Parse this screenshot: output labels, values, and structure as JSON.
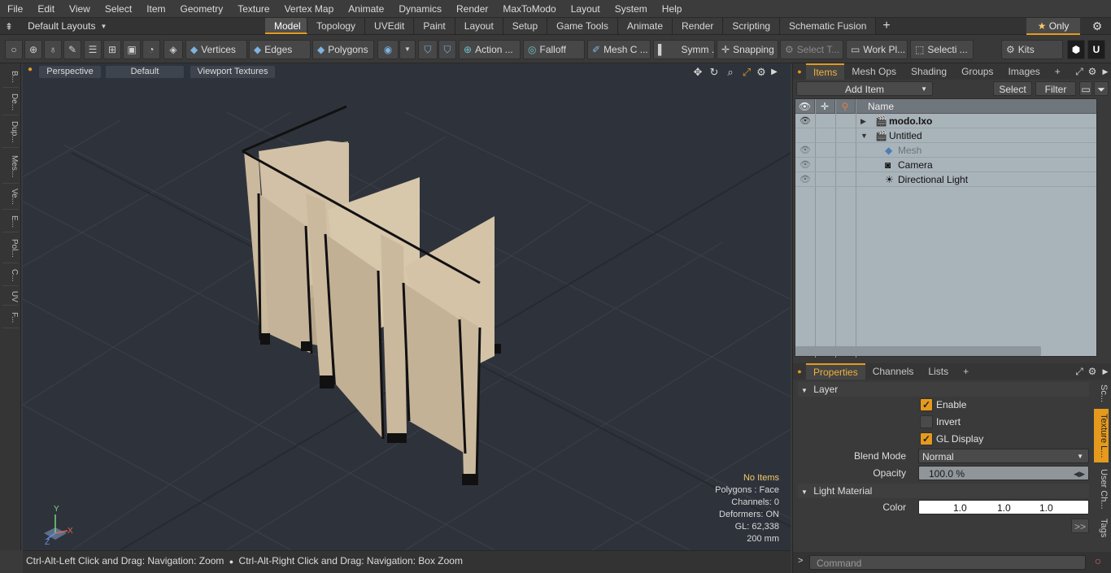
{
  "menubar": {
    "items": [
      "File",
      "Edit",
      "View",
      "Select",
      "Item",
      "Geometry",
      "Texture",
      "Vertex Map",
      "Animate",
      "Dynamics",
      "Render",
      "MaxToModo",
      "Layout",
      "System",
      "Help"
    ]
  },
  "layouts": {
    "selector": "Default Layouts",
    "tabs": [
      "Model",
      "Topology",
      "UVEdit",
      "Paint",
      "Layout",
      "Setup",
      "Game Tools",
      "Animate",
      "Render",
      "Scripting",
      "Schematic Fusion"
    ],
    "active_tab": "Model",
    "only_label": "Only"
  },
  "toolbar": {
    "vertices": "Vertices",
    "edges": "Edges",
    "polygons": "Polygons",
    "action": "Action ...",
    "falloff": "Falloff",
    "mesh_c": "Mesh C ...",
    "symm": "Symm ...",
    "snapping": "Snapping",
    "select_t": "Select T...",
    "work_pl": "Work Pl...",
    "selecti": "Selecti ...",
    "kits": "Kits"
  },
  "leftstrip": {
    "tabs": [
      "B...",
      "De...",
      "Dup...",
      "Mes...",
      "Ve...",
      "E...",
      "Pol...",
      "C...",
      "UV",
      "F..."
    ]
  },
  "viewport": {
    "view": "Perspective",
    "shading": "Default",
    "textures": "Viewport Textures",
    "axis_x": "X",
    "axis_y": "Y",
    "axis_z": "Z",
    "info": {
      "no_items": "No Items",
      "polygons": "Polygons : Face",
      "channels": "Channels: 0",
      "deformers": "Deformers: ON",
      "gl": "GL: 62,338",
      "scale": "200 mm"
    }
  },
  "statusbar": {
    "text_left": "Ctrl-Alt-Left Click and Drag: Navigation: Zoom",
    "text_right": "Ctrl-Alt-Right Click and Drag: Navigation: Box Zoom"
  },
  "items_panel": {
    "tabs": [
      "Items",
      "Mesh Ops",
      "Shading",
      "Groups",
      "Images"
    ],
    "active_tab": "Items",
    "add_item": "Add Item",
    "select": "Select",
    "filter": "Filter",
    "column_name": "Name",
    "rows": [
      {
        "label": "modo.lxo",
        "bold": true
      },
      {
        "label": "Untitled",
        "bold": false
      },
      {
        "label": "Mesh",
        "bold": false
      },
      {
        "label": "Camera",
        "bold": false
      },
      {
        "label": "Directional Light",
        "bold": false
      }
    ]
  },
  "properties_panel": {
    "tabs": [
      "Properties",
      "Channels",
      "Lists"
    ],
    "active_tab": "Properties",
    "layer_section": "Layer",
    "enable": "Enable",
    "invert": "Invert",
    "gl_display": "GL Display",
    "enable_checked": true,
    "invert_checked": false,
    "gl_display_checked": true,
    "blend_mode_label": "Blend Mode",
    "blend_mode_value": "Normal",
    "opacity_label": "Opacity",
    "opacity_value": "100.0 %",
    "light_material_section": "Light Material",
    "color_label": "Color",
    "color_r": "1.0",
    "color_g": "1.0",
    "color_b": "1.0",
    "side_tabs": [
      "Sc...",
      "Texture L...",
      "User Ch...",
      "Tags"
    ],
    "more": ">>"
  },
  "command": {
    "placeholder": "Command"
  },
  "colors": {
    "accent": "#e59a1d",
    "viewport_bg": "#2e333b",
    "panel_list_bg": "#a9b3ba",
    "wood": "#c9b79d"
  }
}
